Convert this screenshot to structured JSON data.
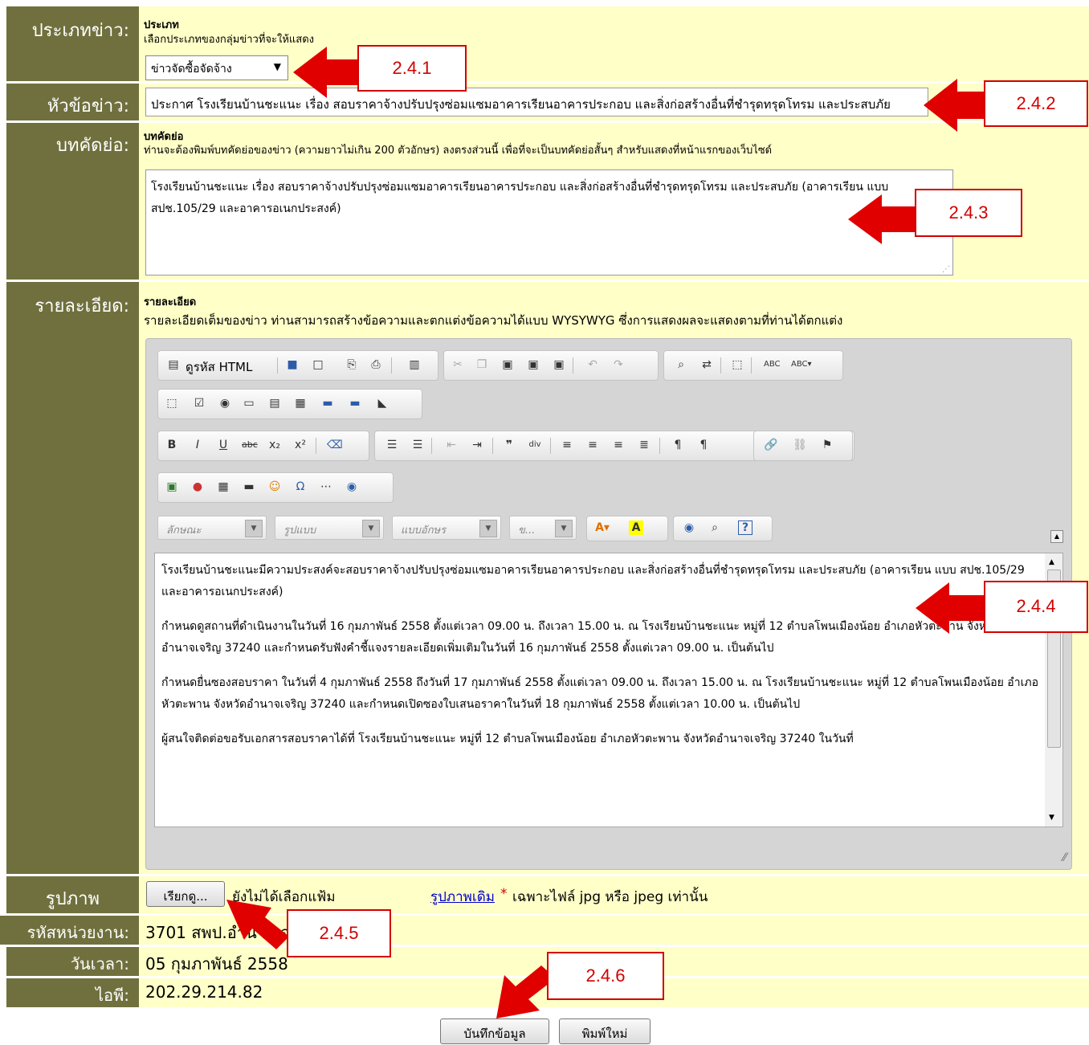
{
  "colors": {
    "label_bg": "#70703e",
    "cell_bg": "#ffffc8",
    "callout": "#d20000",
    "link": "#0000cc"
  },
  "category": {
    "label": "ประเภทข่าว:",
    "title": "ประเภท",
    "hint": "เลือกประเภทของกลุ่มข่าวที่จะให้แสดง",
    "selected": "ข่าวจัดซื้อจัดจ้าง"
  },
  "headline": {
    "label": "หัวข้อข่าว:",
    "value": "ประกาศ โรงเรียนบ้านชะแนะ เรื่อง สอบราคาจ้างปรับปรุงซ่อมแซมอาคารเรียนอาคารประกอบ และสิ่งก่อสร้างอื่นที่ชำรุดทรุดโทรม และประสบภัย"
  },
  "summary": {
    "label": "บทคัดย่อ:",
    "title": "บทคัดย่อ",
    "hint": "ท่านจะต้องพิมพ์บทคัดย่อของข่าว (ความยาวไม่เกิน 200 ตัวอักษร) ลงตรงส่วนนี้ เพื่อที่จะเป็นบทคัดย่อสั้นๆ สำหรับแสดงที่หน้าแรกของเว็บไซด์",
    "value": "โรงเรียนบ้านชะแนะ เรื่อง สอบราคาจ้างปรับปรุงซ่อมแซมอาคารเรียนอาคารประกอบ และสิ่งก่อสร้างอื่นที่ชำรุดทรุดโทรม และประสบภัย (อาคารเรียน แบบ สปช.105/29 และอาคารอเนกประสงค์)"
  },
  "detail": {
    "label": "รายละเอียด:",
    "title": "รายละเอียด",
    "hint": "รายละเอียดเต็มของข่าว ท่านสามารถสร้างข้อความและตกแต่งข้อความได้แบบ WYSYWYG ซึ่งการแสดงผลจะแสดงตามที่ท่านได้ตกแต่ง",
    "toolbar": {
      "source_label": "ดูรหัส HTML",
      "styles_placeholder": "ลักษณะ",
      "format_placeholder": "รูปแบบ",
      "font_placeholder": "แบบอักษร",
      "size_placeholder": "ข..."
    },
    "paragraphs": [
      "โรงเรียนบ้านชะแนะมีความประสงค์จะสอบราคาจ้างปรับปรุงซ่อมแซมอาคารเรียนอาคารประกอบ และสิ่งก่อสร้างอื่นที่ชำรุดทรุดโทรม และประสบภัย (อาคารเรียน แบบ สปช.105/29 และอาคารอเนกประสงค์)",
      "กำหนดดูสถานที่ดำเนินงานในวันที่ 16 กุมภาพันธ์ 2558 ตั้งแต่เวลา 09.00 น. ถึงเวลา 15.00 น. ณ โรงเรียนบ้านชะแนะ หมู่ที่ 12 ตำบลโพนเมืองน้อย อำเภอหัวตะพาน จังหวัดอำนาจเจริญ 37240 และกำหนดรับฟังคำชี้แจงรายละเอียดเพิ่มเติมในวันที่ 16 กุมภาพันธ์ 2558 ตั้งแต่เวลา 09.00 น. เป็นต้นไป",
      "กำหนดยื่นซองสอบราคา ในวันที่ 4 กุมภาพันธ์ 2558 ถึงวันที่ 17 กุมภาพันธ์ 2558 ตั้งแต่เวลา 09.00 น. ถึงเวลา 15.00 น. ณ โรงเรียนบ้านชะแนะ หมู่ที่ 12 ตำบลโพนเมืองน้อย อำเภอหัวตะพาน จังหวัดอำนาจเจริญ 37240 และกำหนดเปิดซองใบเสนอราคาในวันที่ 18 กุมภาพันธ์ 2558 ตั้งแต่เวลา 10.00 น. เป็นต้นไป",
      "ผู้สนใจติดต่อขอรับเอกสารสอบราคาได้ที่ โรงเรียนบ้านชะแนะ หมู่ที่ 12 ตำบลโพนเมืองน้อย อำเภอหัวตะพาน จังหวัดอำนาจเจริญ 37240 ในวันที่"
    ]
  },
  "image": {
    "label": "รูปภาพ",
    "browse_label": "เรียกดู...",
    "no_file": "ยังไม่ได้เลือกแฟ้ม",
    "link": "รูปภาพเดิม",
    "asterisk": "*",
    "note": "เฉพาะไฟล์ jpg หรือ jpeg เท่านั้น"
  },
  "unit": {
    "label": "รหัสหน่วยงาน:",
    "value": "3701 สพป.อำนาจเจริญ"
  },
  "date": {
    "label": "วันเวลา:",
    "value": "05 กุมภาพันธ์ 2558"
  },
  "ip": {
    "label": "ไอพี:",
    "value": "202.29.214.82"
  },
  "actions": {
    "save": "บันทึกข้อมูล",
    "reset": "พิมพ์ใหม่"
  },
  "callouts": [
    "2.4.1",
    "2.4.2",
    "2.4.3",
    "2.4.4",
    "2.4.5",
    "2.4.6"
  ]
}
